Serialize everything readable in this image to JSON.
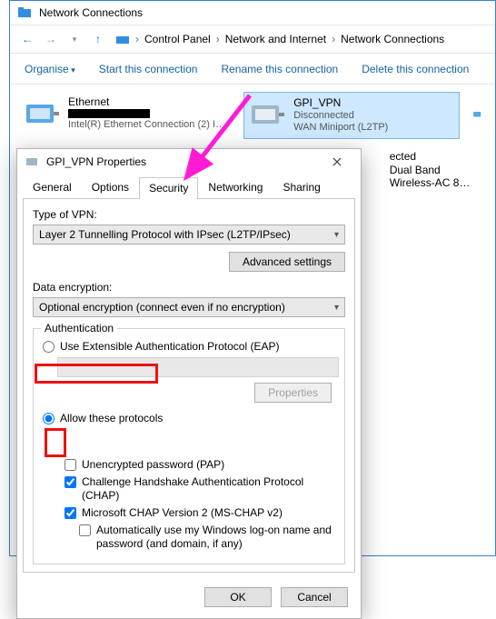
{
  "explorer": {
    "title": "Network Connections",
    "breadcrumbs": [
      "Control Panel",
      "Network and Internet",
      "Network Connections"
    ],
    "toolbar": {
      "organise": "Organise",
      "start": "Start this connection",
      "rename": "Rename this connection",
      "delete": "Delete this connection"
    }
  },
  "connections": {
    "ethernet": {
      "name": "Ethernet",
      "adapter": "Intel(R) Ethernet Connection (2) I…"
    },
    "vpn": {
      "name": "GPI_VPN",
      "status": "Disconnected",
      "adapter": "WAN Miniport (L2TP)"
    },
    "wifi": {
      "status": "ected",
      "adapter": "Dual Band Wireless-AC 8…"
    }
  },
  "dialog": {
    "title": "GPI_VPN Properties",
    "tabs": {
      "general": "General",
      "options": "Options",
      "security": "Security",
      "networking": "Networking",
      "sharing": "Sharing"
    },
    "vpn_type_label": "Type of VPN:",
    "vpn_type_value": "Layer 2 Tunnelling Protocol with IPsec (L2TP/IPsec)",
    "advanced": "Advanced settings",
    "enc_label": "Data encryption:",
    "enc_value": "Optional encryption (connect even if no encryption)",
    "auth_legend": "Authentication",
    "radio_eap": "Use Extensible Authentication Protocol (EAP)",
    "properties_btn": "Properties",
    "radio_allow": "Allow these protocols",
    "chk_pap": "Unencrypted password (PAP)",
    "chk_chap": "Challenge Handshake Authentication Protocol (CHAP)",
    "chk_mschap": "Microsoft CHAP Version 2 (MS-CHAP v2)",
    "chk_winlogon": "Automatically use my Windows log-on name and password (and domain, if any)",
    "ok": "OK",
    "cancel": "Cancel"
  }
}
